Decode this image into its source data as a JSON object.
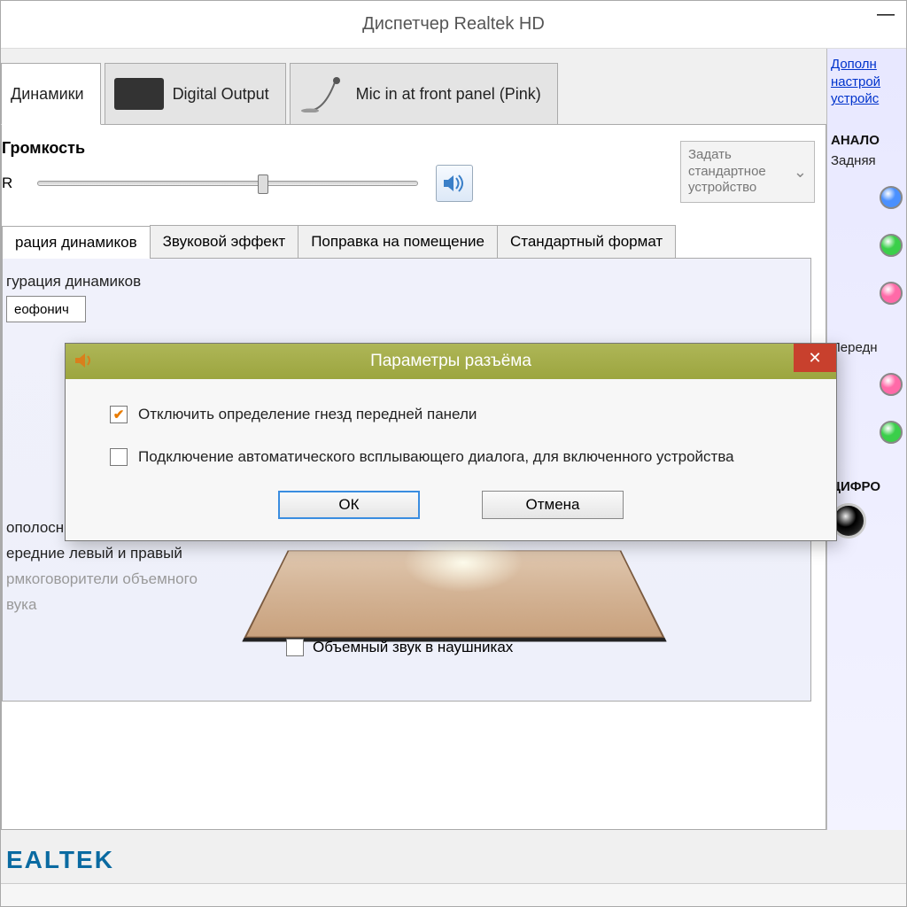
{
  "window": {
    "title": "Диспетчер Realtek HD"
  },
  "device_tabs": [
    {
      "label": "Динамики"
    },
    {
      "label": "Digital Output"
    },
    {
      "label": "Mic in at front panel (Pink)"
    }
  ],
  "main": {
    "volume_label": "Громкость",
    "channel_letter": "R",
    "set_default": "Задать стандартное устройство"
  },
  "subtabs": [
    "рация динамиков",
    "Звуковой эффект",
    "Поправка на помещение",
    "Стандартный формат"
  ],
  "config": {
    "header": "гурация динамиков",
    "dropdown_partial": "еофонич",
    "opt_fullrange": "ополосные громкоговорители",
    "opt_front": "ередние левый и правый",
    "opt_surround": "рмкоговорители объемного\nвука",
    "headphone_surround": "Объемный звук в наушниках"
  },
  "sidebar": {
    "link": "Дополн\nнастрой\nустройс",
    "analog_h": "АНАЛО",
    "analog_sub": "Задняя",
    "front_label": "Передн",
    "digital_h": "ЦИФРО"
  },
  "modal": {
    "title": "Параметры разъёма",
    "opt1": "Отключить определение гнезд передней панели",
    "opt2": "Подключение автоматического всплывающего диалога, для включенного устройства",
    "ok": "ОК",
    "cancel": "Отмена"
  },
  "brand": "EALTEK"
}
